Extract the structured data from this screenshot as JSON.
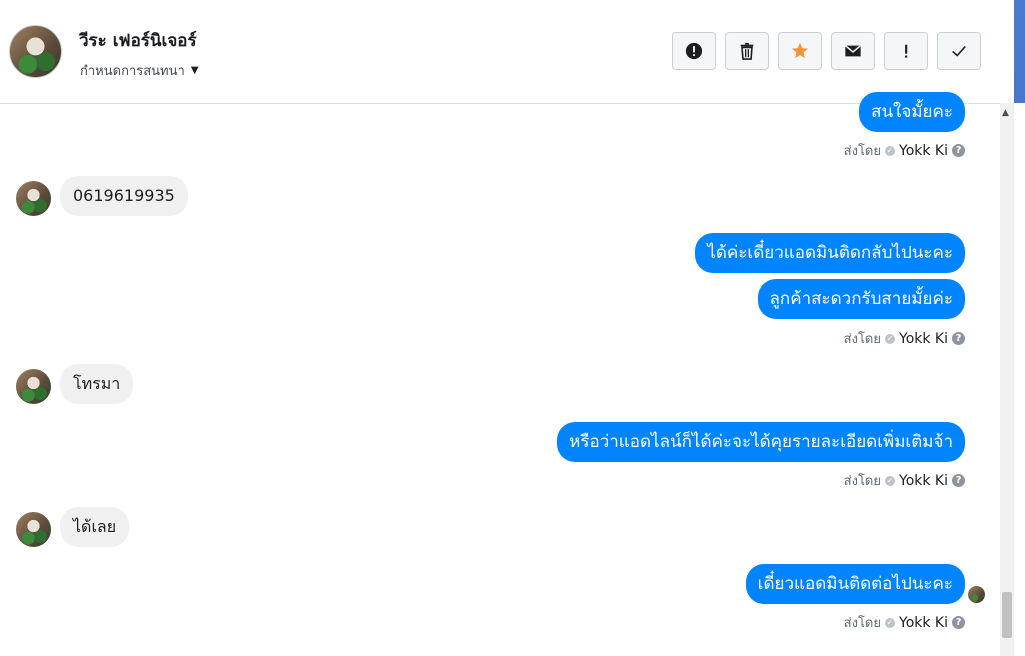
{
  "header": {
    "contact_name": "วีระ เฟอร์นิเจอร์",
    "conversation_settings": "กำหนดการสนทนา",
    "actions": [
      {
        "name": "report-button",
        "icon": "alert-circle-icon"
      },
      {
        "name": "delete-button",
        "icon": "trash-icon"
      },
      {
        "name": "star-button",
        "icon": "star-icon",
        "color": "#f7923a"
      },
      {
        "name": "mark-unread-button",
        "icon": "envelope-icon"
      },
      {
        "name": "important-button",
        "icon": "exclamation-icon"
      },
      {
        "name": "done-button",
        "icon": "check-icon"
      }
    ]
  },
  "messages": [
    {
      "direction": "out",
      "text": "สนใจมั้ยคะ"
    },
    {
      "direction": "in",
      "text": "0619619935"
    },
    {
      "direction": "out",
      "text": "ได้ค่ะเดี๋ยวแอดมินติดกลับไปนะคะ"
    },
    {
      "direction": "out",
      "text": "ลูกค้าสะดวกรับสายมั้ยค่ะ"
    },
    {
      "direction": "in",
      "text": "โทรมา"
    },
    {
      "direction": "out",
      "text": "หรือว่าแอดไลน์ก็ได้ค่ะจะได้คุยรายละเอียดเพิ่มเติมจ้า"
    },
    {
      "direction": "in",
      "text": "ได้เลย"
    },
    {
      "direction": "out",
      "text": "เดี๋ยวแอดมินติดต่อไปนะคะ"
    }
  ],
  "sent_by": {
    "prefix": "ส่งโดย",
    "sender": "Yokk Ki",
    "help": "?"
  },
  "colors": {
    "outgoing_bubble": "#0084ff",
    "incoming_bubble": "#f0f0f0"
  }
}
